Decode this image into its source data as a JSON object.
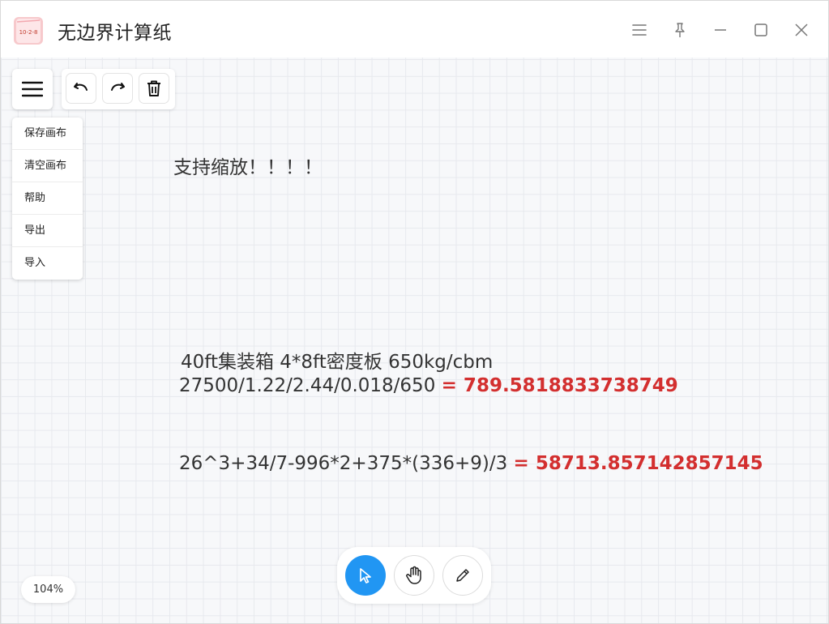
{
  "window": {
    "title": "无边界计算纸",
    "icon_text": "10-2-8"
  },
  "titlebar_buttons": [
    "menu-icon",
    "pin-icon",
    "minimize-icon",
    "maximize-icon",
    "close-icon"
  ],
  "dropdown_menu": {
    "items": [
      "保存画布",
      "清空画布",
      "帮助",
      "导出",
      "导入"
    ]
  },
  "notes": {
    "zoom_text": "支持缩放！！！！",
    "container_line": "40ft集装箱 4*8ft密度板 650kg/cbm",
    "calc1": {
      "expr": "27500/1.22/2.44/0.018/650",
      "result": "= 789.5818833738749"
    },
    "calc2": {
      "expr": "26^3+34/7-996*2+375*(336+9)/3",
      "result": "= 58713.857142857145"
    }
  },
  "zoom": {
    "level": "104%"
  },
  "colors": {
    "accent": "#2196f3",
    "result": "#d32f2f",
    "text": "#333333",
    "canvas_bg": "#f7f8fa",
    "grid": "#e7e9ee"
  }
}
